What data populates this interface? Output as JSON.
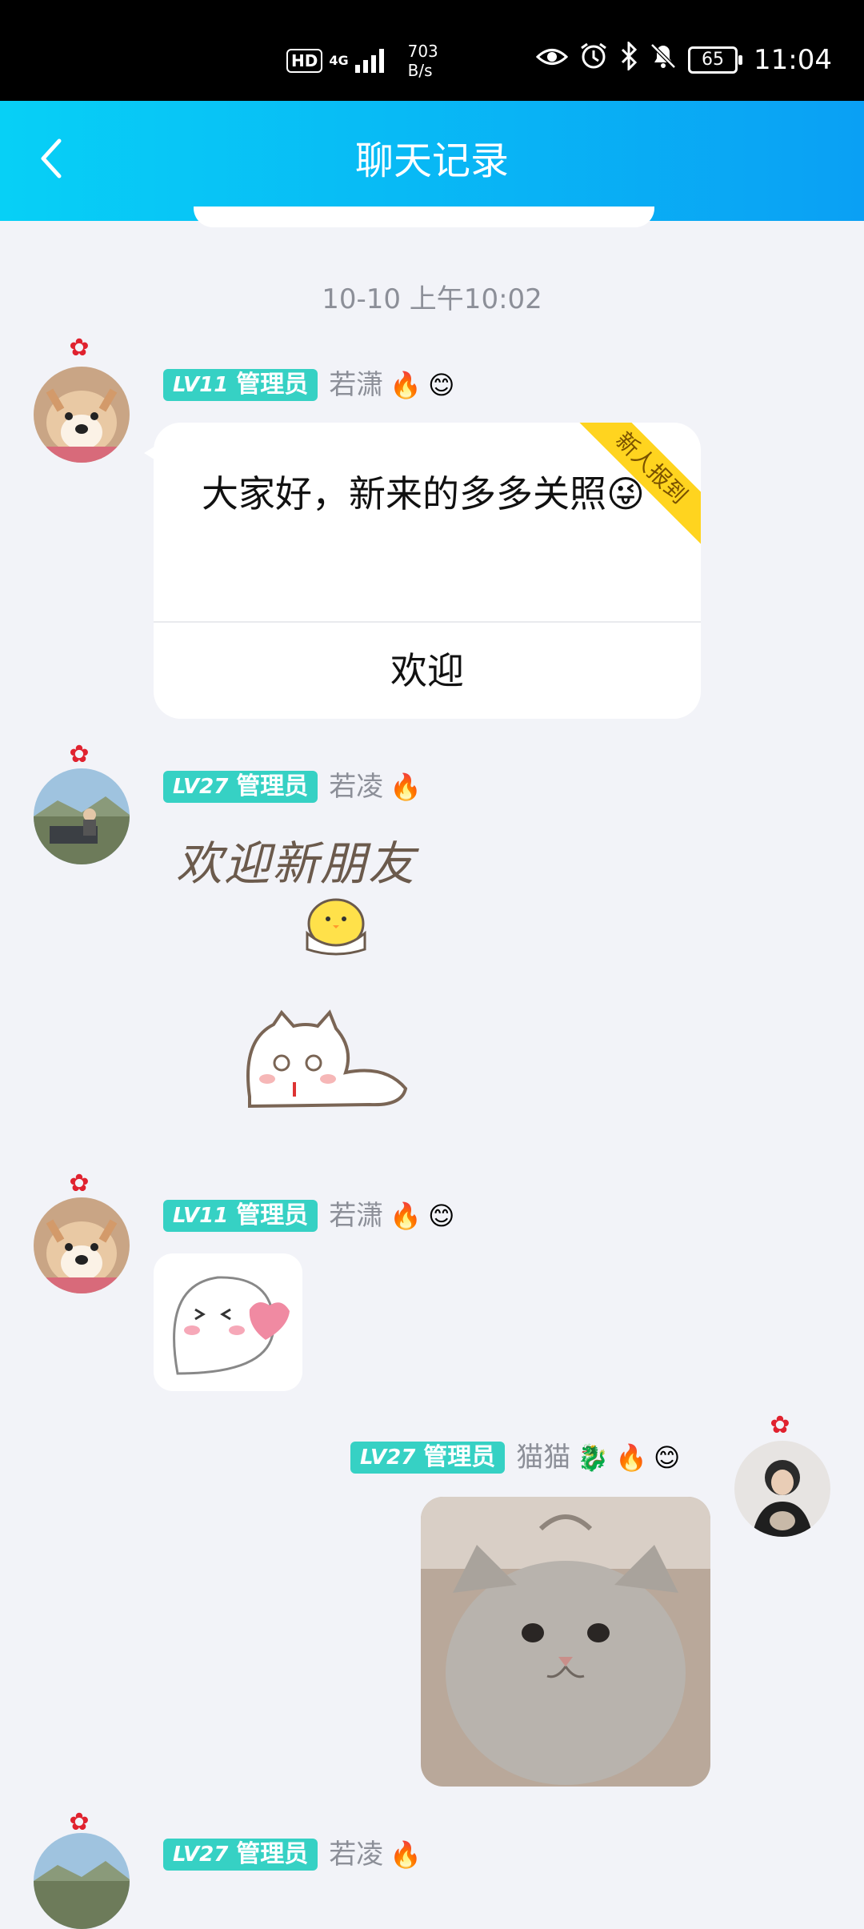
{
  "status_bar": {
    "hd": "HD",
    "network": "4G",
    "speed_value": "703",
    "speed_unit": "B/s",
    "battery": "65",
    "time": "11:04"
  },
  "header": {
    "title": "聊天记录"
  },
  "chat": {
    "timestamp": "10-10 上午10:02",
    "messages": [
      {
        "level": "LV11",
        "role": "管理员",
        "nickname": "若潇",
        "medals": [
          "🔥",
          "😊"
        ],
        "text": "大家好，新来的多多关照😜",
        "tag": "新人报到",
        "action": "欢迎"
      },
      {
        "level": "LV27",
        "role": "管理员",
        "nickname": "若凌",
        "medals": [
          "🔥"
        ],
        "sticker_text": "欢迎新朋友"
      },
      {
        "level": "LV11",
        "role": "管理员",
        "nickname": "若潇",
        "medals": [
          "🔥",
          "😊"
        ]
      },
      {
        "level": "LV27",
        "role": "管理员",
        "nickname": "猫猫",
        "medals": [
          "🐉",
          "🔥",
          "😊"
        ]
      },
      {
        "level": "LV27",
        "role": "管理员",
        "nickname": "若凌",
        "medals": [
          "🔥"
        ]
      }
    ]
  },
  "colors": {
    "header_start": "#07d0f6",
    "header_end": "#0aa0f4",
    "badge": "#36d1c4",
    "background": "#f2f3f8",
    "ribbon": "#ffd41f"
  }
}
